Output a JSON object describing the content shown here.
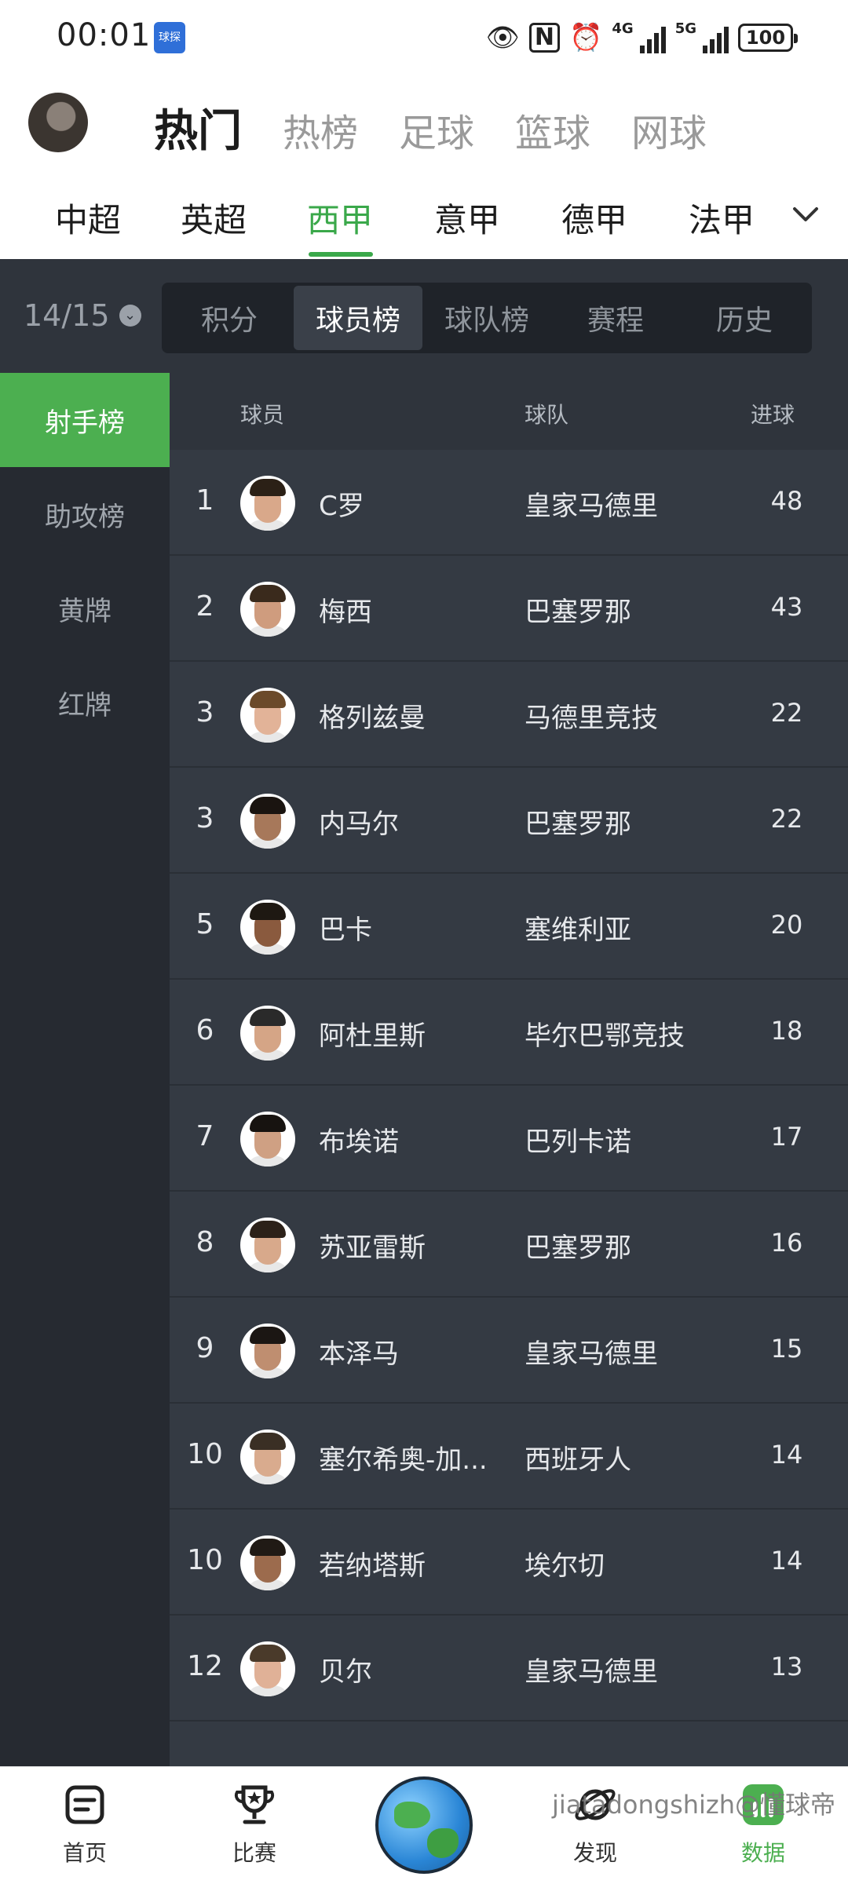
{
  "status_bar": {
    "time": "00:01",
    "app_icon_text": "球探",
    "signal_labels": [
      "4G",
      "5G"
    ],
    "battery": "100"
  },
  "header": {
    "main_tabs": [
      {
        "label": "热门",
        "active": true
      },
      {
        "label": "热榜",
        "active": false
      },
      {
        "label": "足球",
        "active": false
      },
      {
        "label": "篮球",
        "active": false
      },
      {
        "label": "网球",
        "active": false
      }
    ],
    "league_tabs": [
      {
        "label": "中超",
        "active": false
      },
      {
        "label": "英超",
        "active": false
      },
      {
        "label": "西甲",
        "active": true
      },
      {
        "label": "意甲",
        "active": false
      },
      {
        "label": "德甲",
        "active": false
      },
      {
        "label": "法甲",
        "active": false
      }
    ]
  },
  "season": "14/15",
  "sub_tabs": [
    {
      "label": "积分",
      "active": false
    },
    {
      "label": "球员榜",
      "active": true
    },
    {
      "label": "球队榜",
      "active": false
    },
    {
      "label": "赛程",
      "active": false
    },
    {
      "label": "历史",
      "active": false
    }
  ],
  "sidebar": [
    {
      "label": "射手榜",
      "active": true
    },
    {
      "label": "助攻榜",
      "active": false
    },
    {
      "label": "黄牌",
      "active": false
    },
    {
      "label": "红牌",
      "active": false
    }
  ],
  "table": {
    "headers": {
      "player": "球员",
      "team": "球队",
      "goals": "进球"
    },
    "rows": [
      {
        "rank": "1",
        "name": "C罗",
        "team": "皇家马德里",
        "goals": "48"
      },
      {
        "rank": "2",
        "name": "梅西",
        "team": "巴塞罗那",
        "goals": "43"
      },
      {
        "rank": "3",
        "name": "格列兹曼",
        "team": "马德里竞技",
        "goals": "22"
      },
      {
        "rank": "3",
        "name": "内马尔",
        "team": "巴塞罗那",
        "goals": "22"
      },
      {
        "rank": "5",
        "name": "巴卡",
        "team": "塞维利亚",
        "goals": "20"
      },
      {
        "rank": "6",
        "name": "阿杜里斯",
        "team": "毕尔巴鄂竞技",
        "goals": "18"
      },
      {
        "rank": "7",
        "name": "布埃诺",
        "team": "巴列卡诺",
        "goals": "17"
      },
      {
        "rank": "8",
        "name": "苏亚雷斯",
        "team": "巴塞罗那",
        "goals": "16"
      },
      {
        "rank": "9",
        "name": "本泽马",
        "team": "皇家马德里",
        "goals": "15"
      },
      {
        "rank": "10",
        "name": "塞尔希奥-加...",
        "team": "西班牙人",
        "goals": "14"
      },
      {
        "rank": "10",
        "name": "若纳塔斯",
        "team": "埃尔切",
        "goals": "14"
      },
      {
        "rank": "12",
        "name": "贝尔",
        "team": "皇家马德里",
        "goals": "13"
      }
    ]
  },
  "bottom_nav": [
    {
      "label": "首页",
      "icon": "home-icon"
    },
    {
      "label": "比赛",
      "icon": "trophy-icon"
    },
    {
      "label": "",
      "icon": "globe-icon"
    },
    {
      "label": "发现",
      "icon": "planet-icon"
    },
    {
      "label": "数据",
      "icon": "bar-chart-icon"
    }
  ],
  "watermark": "jiatadongshizh@懂球帝",
  "colors": {
    "accent": "#4caf50",
    "bg": "#2b3038",
    "row": "#343a43"
  }
}
